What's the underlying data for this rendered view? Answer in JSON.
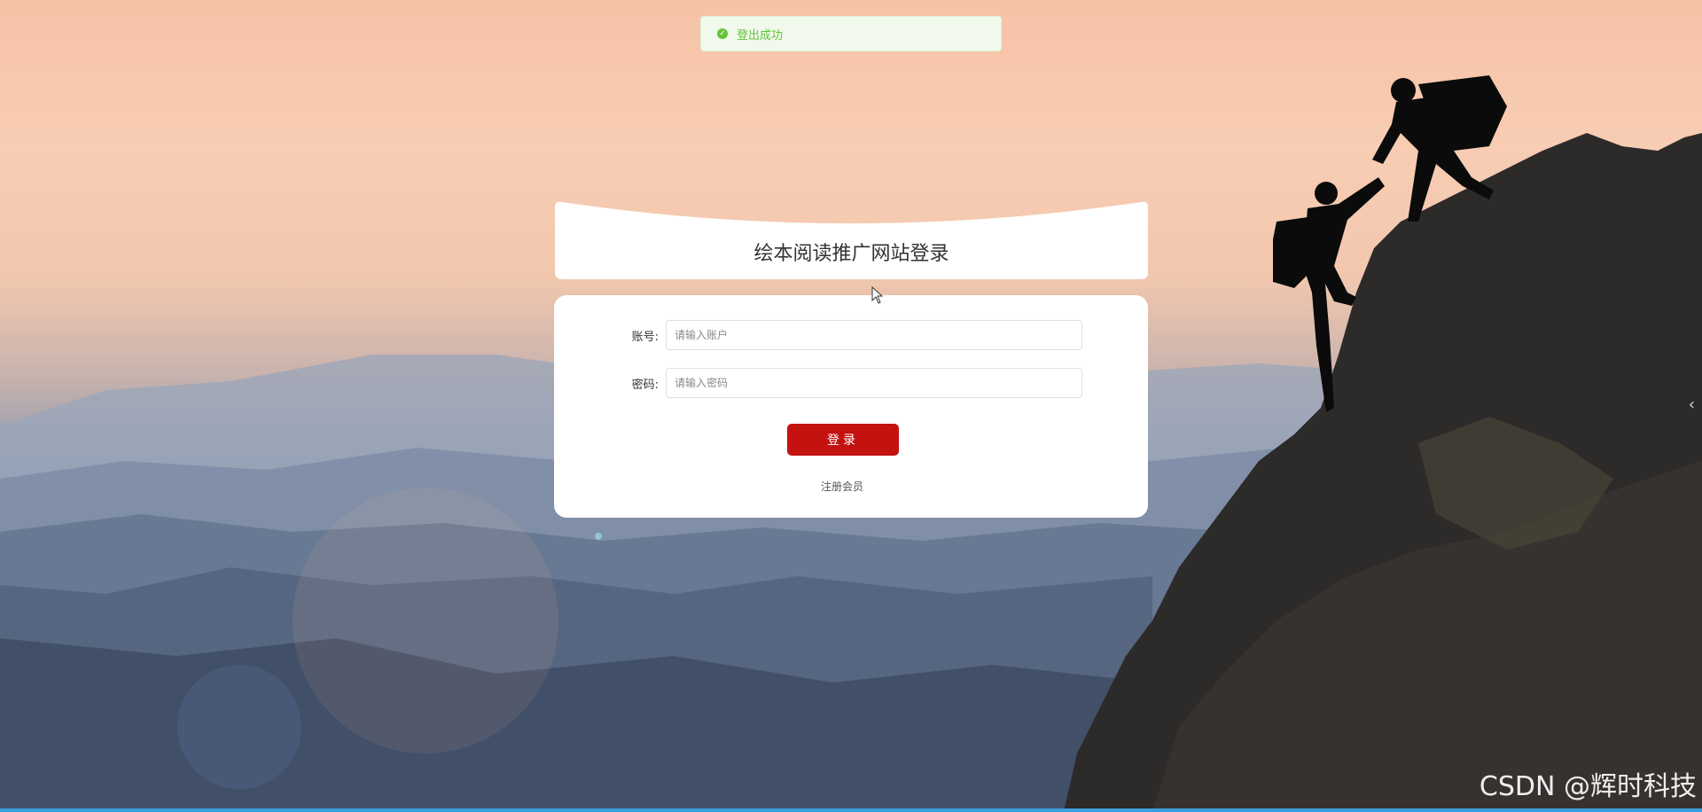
{
  "toast": {
    "message": "登出成功",
    "type": "success",
    "color": "#67c23a"
  },
  "login": {
    "title": "绘本阅读推广网站登录",
    "account_label": "账号:",
    "account_placeholder": "请输入账户",
    "password_label": "密码:",
    "password_placeholder": "请输入密码",
    "submit_label": "登录",
    "register_label": "注册会员",
    "button_color": "#c41210"
  },
  "side_arrow": "‹",
  "watermark": "CSDN @辉时科技"
}
